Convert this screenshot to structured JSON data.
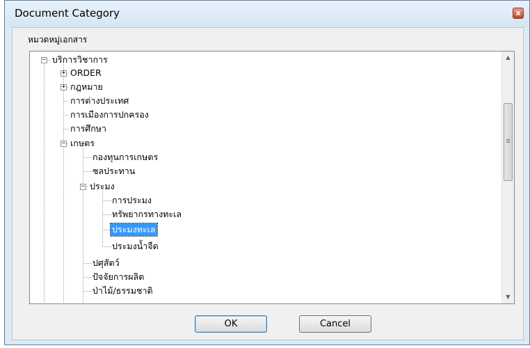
{
  "window": {
    "title": "Document Category",
    "close_glyph": "x"
  },
  "group_label": "หมวดหมู่เอกสาร",
  "tree": {
    "nodes": [
      {
        "label": "บริการวิชาการ",
        "expander": "−"
      },
      {
        "label": "ORDER",
        "expander": "+"
      },
      {
        "label": "กฎหมาย",
        "expander": "+"
      },
      {
        "label": "การต่างประเทศ"
      },
      {
        "label": "การเมืองการปกครอง"
      },
      {
        "label": "การศึกษา"
      },
      {
        "label": "เกษตร",
        "expander": "−"
      },
      {
        "label": "กองทุนการเกษตร"
      },
      {
        "label": "ชลประทาน"
      },
      {
        "label": "ประมง",
        "expander": "−"
      },
      {
        "label": "การประมง"
      },
      {
        "label": "ทรัพยากรทางทะเล"
      },
      {
        "label": "ประมงทะเล",
        "selected": true
      },
      {
        "label": "ประมงน้ำจืด"
      },
      {
        "label": "ปศุสัตว์"
      },
      {
        "label": "ปัจจัยการผลิต"
      },
      {
        "label": "ป่าไม้/ธรรมชาติ"
      }
    ]
  },
  "scrollbar": {
    "up_glyph": "▲",
    "down_glyph": "▼"
  },
  "buttons": {
    "ok_label": "OK",
    "cancel_label": "Cancel"
  },
  "colors": {
    "selection": "#3399ff",
    "dialog_frame": "#dce9f6"
  }
}
